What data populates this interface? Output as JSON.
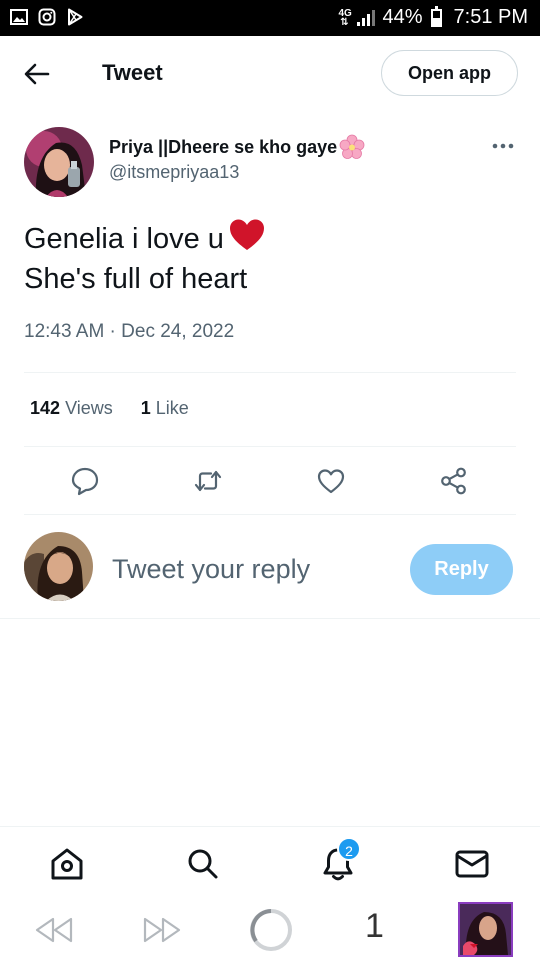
{
  "status_bar": {
    "network": "4G",
    "battery": "44%",
    "time": "7:51 PM",
    "icons": [
      "gallery-icon",
      "instagram-icon",
      "play-store-icon",
      "signal-icon",
      "battery-icon"
    ]
  },
  "header": {
    "title": "Tweet",
    "open_app_label": "Open app",
    "back_icon": "arrow-left-icon"
  },
  "tweet": {
    "author_name": "Priya ||Dheere se kho gaye",
    "author_handle": "@itsmepriyaa13",
    "text_line1": "Genelia i love u",
    "text_line2": "She's full of heart",
    "timestamp": "12:43 AM · Dec 24, 2022",
    "views_count": "142",
    "views_label": "Views",
    "likes_count": "1",
    "likes_label": "Like",
    "emoji_after_name": "cherry-blossom-icon",
    "emoji_in_text": "red-heart-icon"
  },
  "actions": [
    "reply-icon",
    "retweet-icon",
    "like-icon",
    "share-icon"
  ],
  "reply": {
    "placeholder": "Tweet your reply",
    "button_label": "Reply"
  },
  "bottom_nav": {
    "items": [
      "home-icon",
      "search-icon",
      "notifications-icon",
      "messages-icon"
    ],
    "notification_badge": "2"
  },
  "browser_bar": {
    "tab_count": "1",
    "items": [
      "rewind-icon",
      "fast-forward-icon",
      "loading-icon"
    ]
  },
  "colors": {
    "accent": "#1d9bf0",
    "reply_button": "#8ecdf7",
    "secondary_text": "#536471",
    "heart": "#d0142a"
  }
}
